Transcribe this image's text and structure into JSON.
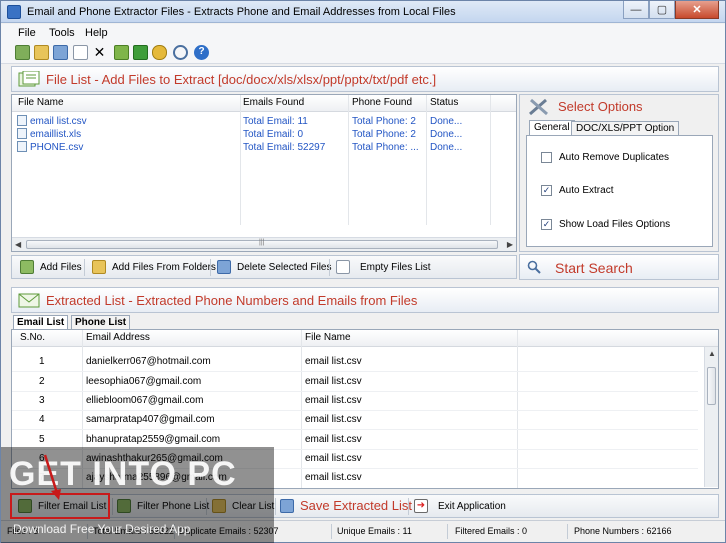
{
  "window": {
    "title": "Email and Phone Extractor Files  -  Extracts Phone and Email Addresses from Local Files",
    "btn_min": "—",
    "btn_max": "▢",
    "btn_close": "✕"
  },
  "menu": {
    "items": [
      "File",
      "Tools",
      "Help"
    ]
  },
  "toolbar": {
    "icons": [
      "add-files-icon",
      "add-folder-icon",
      "save-icon",
      "clear-icon",
      "remove-icon",
      "filter-icon",
      "dollar-icon",
      "key-icon",
      "search-icon",
      "help-icon"
    ]
  },
  "file_list": {
    "title": "File List - Add Files to Extract  [doc/docx/xls/xlsx/ppt/pptx/txt/pdf etc.]",
    "columns": [
      "File Name",
      "Emails Found",
      "Phone Found",
      "Status"
    ],
    "rows": [
      {
        "name": "email list.csv",
        "emails": "Total Email: 11",
        "phone": "Total Phone: 2",
        "status": "Done..."
      },
      {
        "name": "emaillist.xls",
        "emails": "Total Email: 0",
        "phone": "Total Phone: 2",
        "status": "Done..."
      },
      {
        "name": "PHONE.csv",
        "emails": "Total Email: 52297",
        "phone": "Total Phone: ...",
        "status": "Done..."
      }
    ],
    "scroll_grip": "|||"
  },
  "file_buttons": {
    "add_files": "Add Files",
    "add_folders": "Add Files From Folders",
    "delete_selected": "Delete Selected Files",
    "empty_list": "Empty Files List"
  },
  "options": {
    "title": "Select Options",
    "tabs": [
      "General",
      "DOC/XLS/PPT Option"
    ],
    "checkboxes": [
      {
        "label": "Auto Remove Duplicates",
        "checked": false,
        "mark": ""
      },
      {
        "label": "Auto Extract",
        "checked": true,
        "mark": "✓"
      },
      {
        "label": "Show Load Files Options",
        "checked": true,
        "mark": "✓"
      }
    ]
  },
  "search": {
    "label": "Start Search"
  },
  "extracted": {
    "title": "Extracted List - Extracted Phone Numbers and Emails from Files",
    "tabs": [
      "Email List",
      "Phone List"
    ],
    "columns": [
      "S.No.",
      "Email Address",
      "File Name"
    ],
    "rows": [
      {
        "sno": "1",
        "email": "danielkerr067@hotmail.com",
        "file": "email list.csv"
      },
      {
        "sno": "2",
        "email": "leesophia067@gmail.com",
        "file": "email list.csv"
      },
      {
        "sno": "3",
        "email": "elliebloom067@gmail.com",
        "file": "email list.csv"
      },
      {
        "sno": "4",
        "email": "samarpratap407@gmail.com",
        "file": "email list.csv"
      },
      {
        "sno": "5",
        "email": "bhanupratap2559@gmail.com",
        "file": "email list.csv"
      },
      {
        "sno": "6",
        "email": "awinashthakur265@gmail.com",
        "file": "email list.csv"
      },
      {
        "sno": "7",
        "email": "ajaysharma255896@gmail.com",
        "file": "email list.csv"
      }
    ]
  },
  "bottom_buttons": {
    "filter_email": "Filter Email List",
    "filter_phone": "Filter Phone List",
    "clear": "Clear List",
    "save": "Save Extracted List",
    "exit": "Exit Application"
  },
  "status": {
    "files": "Files : 3",
    "total_emails": "Total Emails : 52322",
    "duplicate_emails": "Duplicate Emails :  52307",
    "unique_emails": "Unique Emails :  11",
    "filtered_emails": "Filtered Emails :  0",
    "phone_numbers": "Phone Numbers :  62166"
  },
  "watermark": {
    "main": "GET INTO PC",
    "sub": "Download Free Your Desired App"
  },
  "colors": {
    "accent_red": "#c23a2a",
    "link_blue": "#2255c4",
    "title_bar": "#c4d6ef"
  }
}
